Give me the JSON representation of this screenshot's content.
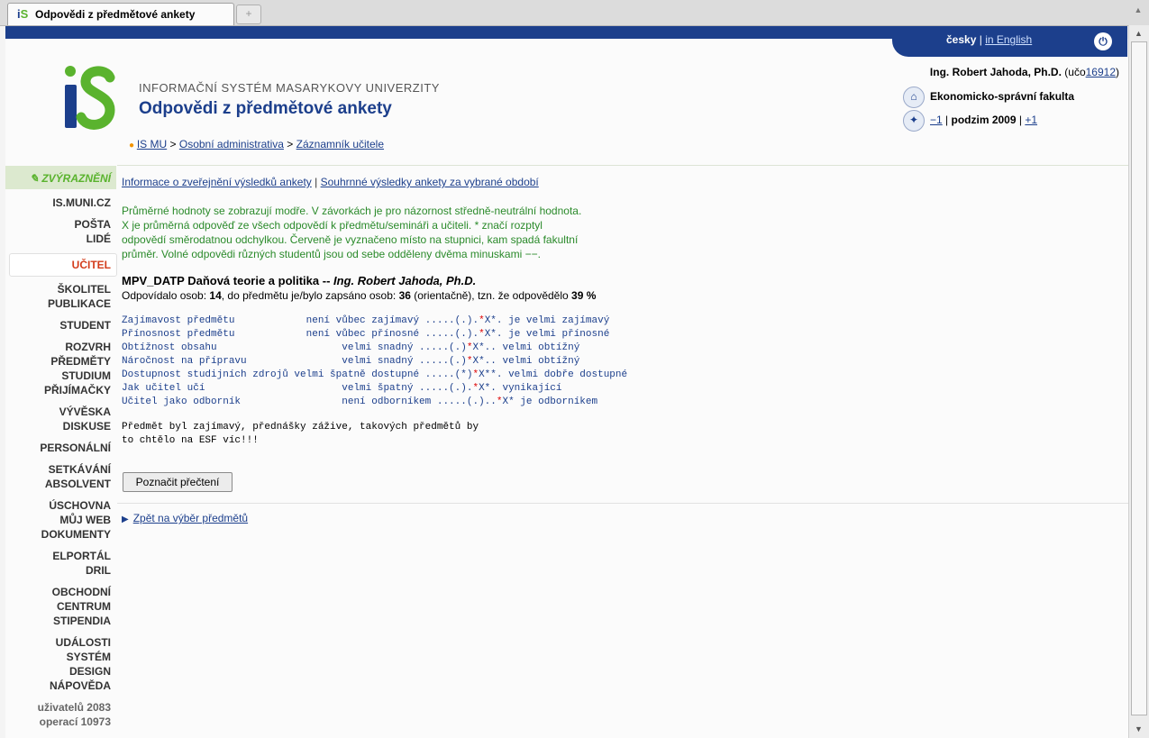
{
  "browser": {
    "tab_title": "Odpovědi z předmětové ankety",
    "new_tab": "+"
  },
  "header": {
    "lang_current": "česky",
    "lang_sep": "|",
    "lang_other": "in English",
    "system_name": "INFORMAČNÍ SYSTÉM MASARYKOVY UNIVERZITY",
    "page_title": "Odpovědi z předmětové ankety",
    "breadcrumb": [
      "IS MU",
      ">",
      "Osobní administrativa",
      ">",
      "Záznamník učitele"
    ],
    "user_name": "Ing. Robert Jahoda, Ph.D.",
    "user_uco_prefix": "(učo",
    "user_uco": "16912",
    "user_uco_suffix": ")",
    "faculty": "Ekonomicko-správní fakulta",
    "semester_prev": "−1",
    "semester_sep1": "|",
    "semester_name": "podzim 2009",
    "semester_sep2": "|",
    "semester_next": "+1"
  },
  "sidebar": {
    "highlight": "ZVÝRAZNĚNÍ",
    "items": [
      "IS.MUNI.CZ",
      "POŠTA",
      "LIDÉ",
      "UČITEL",
      "ŠKOLITEL",
      "PUBLIKACE",
      "STUDENT",
      "ROZVRH",
      "PŘEDMĚTY",
      "STUDIUM",
      "PŘIJÍMAČKY",
      "VÝVĚSKA",
      "DISKUSE",
      "PERSONÁLNÍ",
      "SETKÁVÁNÍ",
      "ABSOLVENT",
      "ÚSCHOVNA",
      "MŮJ WEB",
      "DOKUMENTY",
      "ELPORTÁL",
      "DRIL",
      "OBCHODNÍ",
      "CENTRUM",
      "STIPENDIA",
      "UDÁLOSTI",
      "SYSTÉM",
      "DESIGN",
      "NÁPOVĚDA"
    ],
    "stat_users": "uživatelů 2083",
    "stat_ops": "operací 10973"
  },
  "main": {
    "link_info": "Informace o zveřejnění výsledků ankety",
    "link_sep": "|",
    "link_summary": "Souhrnné výsledky ankety za vybrané období",
    "note_lines": [
      "Průměrné hodnoty se zobrazují modře. V závorkách je pro názornost středně-neutrální hodnota.",
      "X je průměrná odpověď ze všech odpovědí k předmětu/semináři a učiteli. * značí rozptyl",
      "odpovědí směrodatnou odchylkou. Červeně je vyznačeno místo na stupnici, kam spadá fakultní",
      "průměr. Volné odpovědi různých studentů jsou od sebe odděleny dvěma minuskami −−."
    ],
    "subject_code_name": "MPV_DATP Daňová teorie a politika",
    "subject_sep": " -- ",
    "subject_teacher": "Ing. Robert Jahoda, Ph.D.",
    "count_prefix": "Odpovídalo osob: ",
    "count_respondents": "14",
    "count_mid": ", do předmětu je/bylo zapsáno osob: ",
    "count_enrolled": "36",
    "count_mid2": " (orientačně), tzn. že odpovědělo ",
    "count_percent": "39 %",
    "results": [
      {
        "a": "Zajímavost předmětu            není vůbec zajímavý .....(.).",
        "r": "*",
        "b": "X*. je velmi zajímavý"
      },
      {
        "a": "Přínosnost předmětu            není vůbec přínosné .....(.).",
        "r": "*",
        "b": "X*. je velmi přínosné"
      },
      {
        "a": "Obtížnost obsahu                     velmi snadný .....(.)",
        "r": "*",
        "b": "X*.. velmi obtížný"
      },
      {
        "a": "Náročnost na přípravu                velmi snadný .....(.)",
        "r": "*",
        "b": "X*.. velmi obtížný"
      },
      {
        "a": "Dostupnost studijních zdrojů velmi špatně dostupné .....(*)",
        "r": "*",
        "b": "X**. velmi dobře dostupné"
      },
      {
        "a": "Jak učitel učí                       velmi špatný .....(.).",
        "r": "*",
        "b": "X*. vynikající"
      },
      {
        "a": "Učitel jako odborník                 není odborníkem .....(.)..",
        "r": "*",
        "b": "X* je odborníkem"
      }
    ],
    "comment_lines": [
      "Předmět byl zajímavý, přednášky zážive, takových předmětů by",
      "to chtělo na ESF víc!!!"
    ],
    "mark_read_button": "Poznačit přečtení",
    "back_link": "Zpět na výběr předmětů"
  }
}
